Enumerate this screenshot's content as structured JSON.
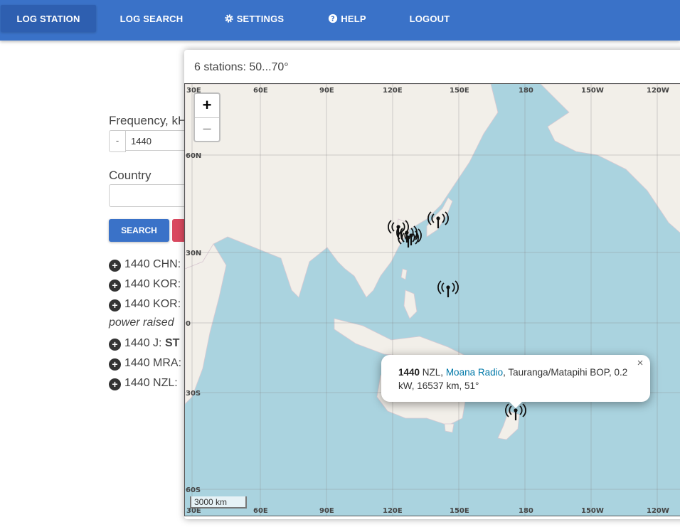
{
  "nav": {
    "items": [
      {
        "label": "LOG STATION",
        "icon": ""
      },
      {
        "label": "LOG SEARCH",
        "icon": ""
      },
      {
        "label": "SETTINGS",
        "icon": "gear-icon"
      },
      {
        "label": "HELP",
        "icon": "help-icon"
      },
      {
        "label": "LOGOUT",
        "icon": ""
      }
    ]
  },
  "form": {
    "frequency_label": "Frequency, kH",
    "minus": "-",
    "frequency_value": "1440",
    "country_label": "Country",
    "search_label": "SEARCH"
  },
  "results": [
    {
      "prefix": "1440 CHN:",
      "bold": ""
    },
    {
      "prefix": "1440 KOR:",
      "bold": ""
    },
    {
      "prefix": "1440 KOR:",
      "bold": ""
    },
    {
      "prefix": "1440 J: ",
      "bold": "ST"
    },
    {
      "prefix": "1440 MRA:",
      "bold": ""
    },
    {
      "prefix": "1440 NZL:",
      "bold": ""
    }
  ],
  "note": "power raised",
  "modal": {
    "title": "6 stations: 50...70°",
    "map": {
      "top_labels": [
        "30E",
        "60E",
        "90E",
        "120E",
        "150E",
        "180",
        "150W",
        "120W"
      ],
      "bottom_labels": [
        "30E",
        "60E",
        "90E",
        "120E",
        "150E",
        "180",
        "150W",
        "120W"
      ],
      "lat_labels": [
        "60N",
        "30N",
        "0",
        "30S",
        "60S"
      ],
      "zoom_in": "+",
      "zoom_out": "−",
      "scale_label": "3000 km",
      "popup": {
        "freq": "1440",
        "country": " NZL, ",
        "station": "Moana Radio",
        "rest": ", Tauranga/Matapihi BOP, 0.2 kW, 16537 km, 51°",
        "close": "×"
      },
      "station_markers": 7
    }
  },
  "colors": {
    "nav": "#3a72c8",
    "water": "#aad3df",
    "land": "#f2efe9",
    "link": "#0078a8"
  }
}
